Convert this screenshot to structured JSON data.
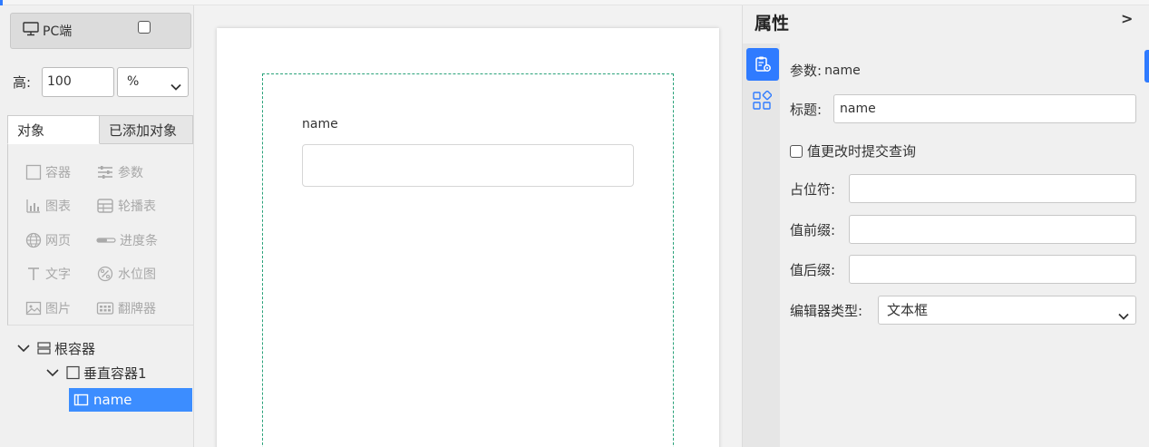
{
  "left_panel": {
    "device_button": {
      "icon": "monitor-icon",
      "label": "PC端"
    },
    "height": {
      "label": "高:",
      "value": "100",
      "unit": "%"
    },
    "tabs": [
      {
        "label": "对象"
      },
      {
        "label": "已添加对象"
      }
    ],
    "objects": [
      {
        "label": "容器",
        "icon": "container-icon"
      },
      {
        "label": "参数",
        "icon": "sliders-icon"
      },
      {
        "label": "图表",
        "icon": "bar-chart-icon"
      },
      {
        "label": "轮播表",
        "icon": "carousel-table-icon"
      },
      {
        "label": "网页",
        "icon": "globe-icon"
      },
      {
        "label": "进度条",
        "icon": "progress-bar-icon"
      },
      {
        "label": "文字",
        "icon": "text-icon"
      },
      {
        "label": "水位图",
        "icon": "percent-gauge-icon"
      },
      {
        "label": "图片",
        "icon": "image-icon"
      },
      {
        "label": "翻牌器",
        "icon": "flip-counter-icon"
      }
    ],
    "tree": {
      "root": {
        "label": "根容器"
      },
      "child": {
        "label": "垂直容器1"
      },
      "leaf": {
        "label": "name"
      }
    }
  },
  "canvas": {
    "field_label": "name"
  },
  "properties": {
    "title": "属性",
    "collapse": ">",
    "param_label": "参数:",
    "param_value": "name",
    "title_label": "标题:",
    "title_value": "name",
    "submit_checkbox_label": "值更改时提交查询",
    "placeholder_label": "占位符:",
    "prefix_label": "值前缀:",
    "suffix_label": "值后缀:",
    "editor_type_label": "编辑器类型:",
    "editor_type_value": "文本框"
  },
  "colors": {
    "accent": "#2f7bff",
    "container_border": "#2aa27a",
    "selected_row": "#3c8dff"
  }
}
